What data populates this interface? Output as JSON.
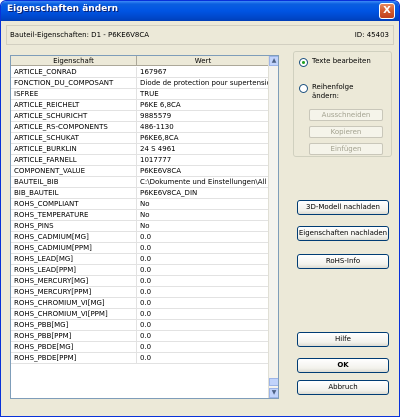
{
  "window": {
    "title": "Eigenschaften ändern",
    "close_label": "X"
  },
  "info": {
    "left": "Bauteil-Eigenschaften: D1 - P6KE6V8CA",
    "right": "ID: 45403"
  },
  "table": {
    "headers": [
      "Eigenschaft",
      "Wert"
    ],
    "rows": [
      [
        "ARTICLE_CONRAD",
        "167967"
      ],
      [
        "FONCTION_DU_COMPOSANT",
        "Diode de protection pour supertension"
      ],
      [
        "ISFREE",
        "TRUE"
      ],
      [
        "ARTICLE_REICHELT",
        "P6KE 6,8CA"
      ],
      [
        "ARTICLE_SCHURICHT",
        "9885579"
      ],
      [
        "ARTICLE_RS-COMPONENTS",
        "486-1130"
      ],
      [
        "ARTICLE_SCHUKAT",
        "P6KE6,8CA"
      ],
      [
        "ARTICLE_BURKLIN",
        "24 S 4961"
      ],
      [
        "ARTICLE_FARNELL",
        "1017777"
      ],
      [
        "COMPONENT_VALUE",
        "P6KE6V8CA"
      ],
      [
        "BAUTEIL_BIB",
        "C:\\Dokumente und Einstellungen\\All U"
      ],
      [
        "BIB_BAUTEIL",
        "P6KE6V8CA_DIN"
      ],
      [
        "ROHS_COMPLIANT",
        "No"
      ],
      [
        "ROHS_TEMPERATURE",
        "No"
      ],
      [
        "ROHS_PINS",
        "No"
      ],
      [
        "ROHS_CADMIUM[MG]",
        "0.0"
      ],
      [
        "ROHS_CADMIUM[PPM]",
        "0.0"
      ],
      [
        "ROHS_LEAD[MG]",
        "0.0"
      ],
      [
        "ROHS_LEAD[PPM]",
        "0.0"
      ],
      [
        "ROHS_MERCURY[MG]",
        "0.0"
      ],
      [
        "ROHS_MERCURY[PPM]",
        "0.0"
      ],
      [
        "ROHS_CHROMIUM_VI[MG]",
        "0.0"
      ],
      [
        "ROHS_CHROMIUM_VI[PPM]",
        "0.0"
      ],
      [
        "ROHS_PBB[MG]",
        "0.0"
      ],
      [
        "ROHS_PBB[PPM]",
        "0.0"
      ],
      [
        "ROHS_PBDE[MG]",
        "0.0"
      ],
      [
        "ROHS_PBDE[PPM]",
        "0.0"
      ]
    ]
  },
  "mode": {
    "option_text": "Texte bearbeiten",
    "option_order": "Reihenfolge ändern:",
    "selected": "option_text",
    "cut": "Ausschneiden",
    "copy": "Kopieren",
    "paste": "Einfügen"
  },
  "buttons": {
    "model3d": "3D-Modell nachladen",
    "reload_props": "Eigenschaften nachladen",
    "rohs": "RoHS-Info",
    "help": "Hilfe",
    "ok": "OK",
    "cancel": "Abbruch"
  },
  "scrollbar": {
    "up_icon": "▲",
    "down_icon": "▼"
  },
  "colors": {
    "titlebar": "#0054e3",
    "face": "#ece9d8",
    "grid_border": "#7f9db9"
  }
}
